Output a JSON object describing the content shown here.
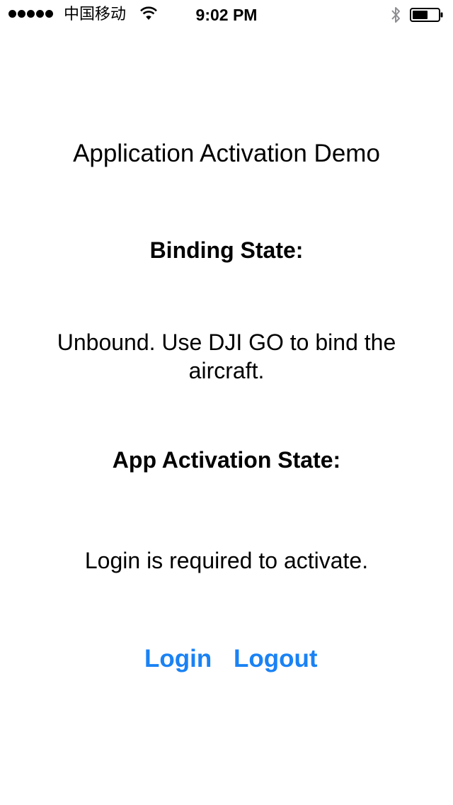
{
  "status_bar": {
    "carrier": "中国移动",
    "time": "9:02 PM",
    "signal_bars": 5,
    "icons": [
      "wifi-icon",
      "bluetooth-icon",
      "battery-icon"
    ],
    "battery_level": 0.6
  },
  "main": {
    "title": "Application Activation Demo",
    "binding": {
      "heading": "Binding State:",
      "value": "Unbound. Use DJI GO to bind the aircraft."
    },
    "activation": {
      "heading": "App Activation State:",
      "value": "Login is required to activate."
    },
    "actions": {
      "login_label": "Login",
      "logout_label": "Logout"
    }
  },
  "colors": {
    "accent": "#1a82f4",
    "text": "#000000",
    "background": "#ffffff"
  }
}
